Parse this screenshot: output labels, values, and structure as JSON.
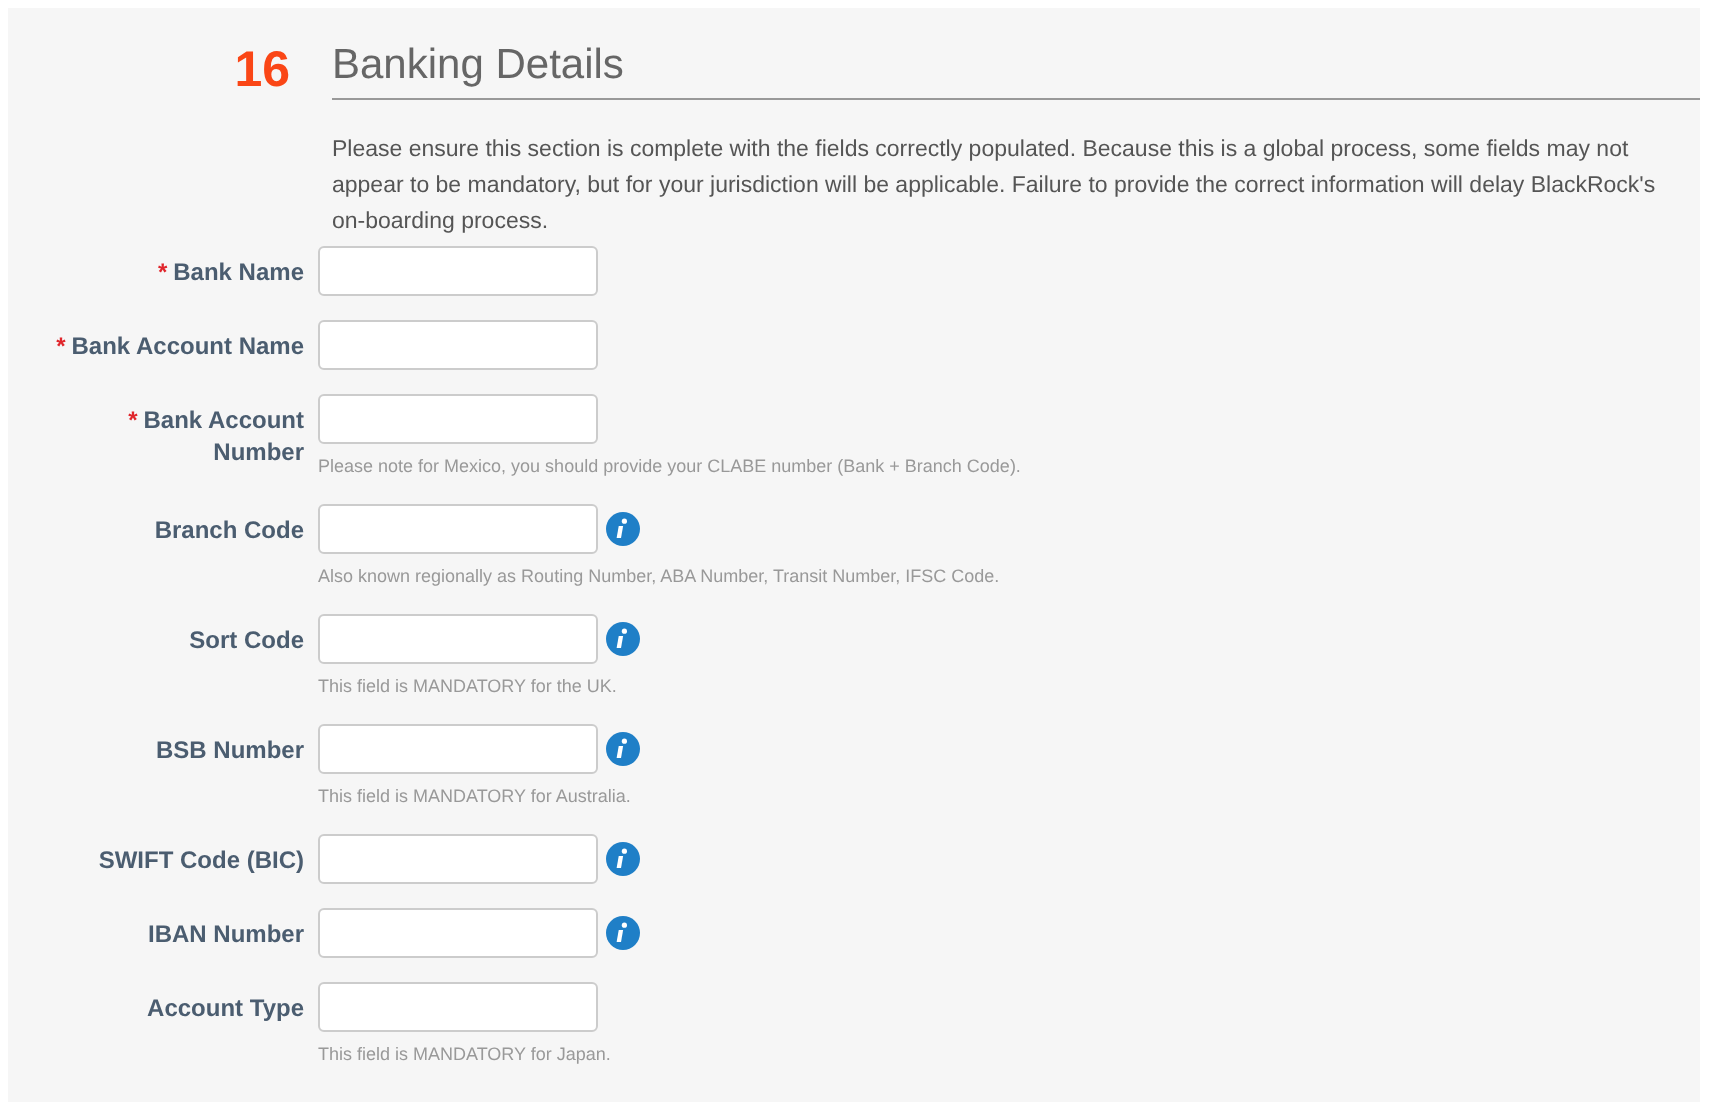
{
  "section": {
    "number": "16",
    "title": "Banking Details",
    "description": "Please ensure this section is complete with the fields correctly populated. Because this is a global process, some fields may not appear to be mandatory, but for your jurisdiction will be applicable. Failure to provide the correct information will delay BlackRock's on-boarding process."
  },
  "fields": [
    {
      "required_mark": "*",
      "label": "Bank Name",
      "info": false
    },
    {
      "required_mark": "*",
      "label": "Bank Account Name",
      "info": false
    },
    {
      "required_mark": "*",
      "label": "Bank Account Number",
      "info": false,
      "note": "Please note for Mexico, you should provide your CLABE number (Bank + Branch Code)."
    },
    {
      "label": "Branch Code",
      "info": true,
      "note": "Also known regionally as Routing Number, ABA Number, Transit Number, IFSC Code."
    },
    {
      "label": "Sort Code",
      "info": true,
      "note": "This field is MANDATORY for the UK."
    },
    {
      "label": "BSB Number",
      "info": true,
      "note": "This field is MANDATORY for Australia."
    },
    {
      "label": "SWIFT Code (BIC)",
      "info": true
    },
    {
      "label": "IBAN Number",
      "info": true
    },
    {
      "label": "Account Type",
      "info": false,
      "note": "This field is MANDATORY for Japan."
    }
  ]
}
